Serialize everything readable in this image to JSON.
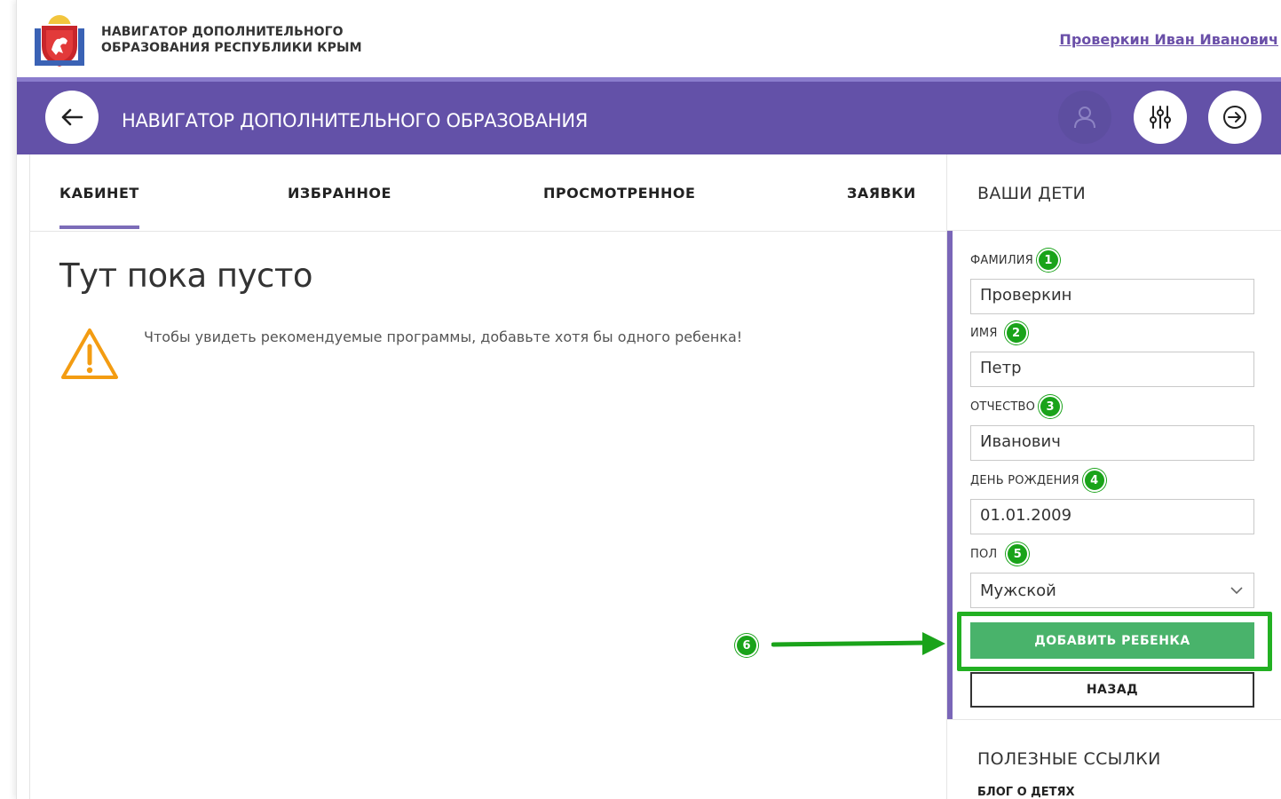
{
  "topbar": {
    "site_name_line1": "НАВИГАТОР ДОПОЛНИТЕЛЬНОГО",
    "site_name_line2": "ОБРАЗОВАНИЯ РЕСПУБЛИКИ КРЫМ",
    "user_name": "Проверкин Иван Иванович"
  },
  "header": {
    "title": "НАВИГАТОР ДОПОЛНИТЕЛЬНОГО ОБРАЗОВАНИЯ",
    "icons": [
      "arrow-left-icon",
      "user-icon",
      "sliders-icon",
      "logout-icon"
    ]
  },
  "tabs": [
    {
      "label": "КАБИНЕТ",
      "active": true
    },
    {
      "label": "ИЗБРАННОЕ",
      "active": false
    },
    {
      "label": "ПРОСМОТРЕННОЕ",
      "active": false
    },
    {
      "label": "ЗАЯВКИ",
      "active": false
    }
  ],
  "main": {
    "empty_title": "Тут пока пусто",
    "warning_text": "Чтобы увидеть рекомендуемые программы, добавьте хотя бы одного ребенка!",
    "annotation_6": "6"
  },
  "kids_form": {
    "title": "ВАШИ ДЕТИ",
    "fields": [
      {
        "label": "ФАМИЛИЯ",
        "badge": "1",
        "value": "Проверкин"
      },
      {
        "label": "ИМЯ",
        "badge": "2",
        "value": "Петр"
      },
      {
        "label": "ОТЧЕСТВО",
        "badge": "3",
        "value": "Иванович"
      },
      {
        "label": "ДЕНЬ РОЖДЕНИЯ",
        "badge": "4",
        "value": "01.01.2009"
      },
      {
        "label": "ПОЛ",
        "badge": "5",
        "value": "Мужской"
      }
    ],
    "add_button": "ДОБАВИТЬ РЕБЕНКА",
    "back_button": "НАЗАД"
  },
  "useful_links": {
    "title": "ПОЛЕЗНЫЕ ССЫЛКИ",
    "items": [
      "БЛОГ О ДЕТЯХ"
    ]
  },
  "colors": {
    "header_purple": "#6351a8",
    "add_button_green": "#49b36b",
    "annotation_green": "#1aa31a",
    "warning_orange": "#f39c12",
    "user_link_purple": "#6a4fa8"
  }
}
